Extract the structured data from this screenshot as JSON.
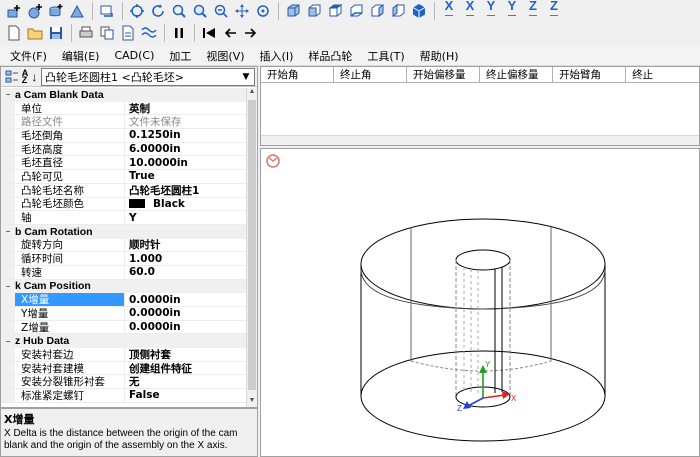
{
  "toolbar1": {
    "axis_labels": [
      "X",
      "X",
      "Y",
      "Y",
      "Z",
      "Z"
    ]
  },
  "menubar": {
    "items": [
      "文件(F)",
      "编辑(E)",
      "CAD(C)",
      "加工",
      "视图(V)",
      "插入(I)",
      "样品凸轮",
      "工具(T)",
      "帮助(H)"
    ]
  },
  "property_panel": {
    "object_selector": "凸轮毛坯圆柱1 <凸轮毛坯>",
    "categories": [
      {
        "title": "a Cam Blank Data",
        "rows": [
          {
            "name": "单位",
            "value": "英制"
          },
          {
            "name": "路径文件",
            "value": "文件未保存"
          },
          {
            "name": "毛坯倒角",
            "value": "0.1250in"
          },
          {
            "name": "毛坯高度",
            "value": "6.0000in"
          },
          {
            "name": "毛坯直径",
            "value": "10.0000in"
          },
          {
            "name": "凸轮可见",
            "value": "True"
          },
          {
            "name": "凸轮毛坯名称",
            "value": "凸轮毛坯圆柱1"
          },
          {
            "name": "凸轮毛坯颜色",
            "value": "Black"
          },
          {
            "name": "轴",
            "value": "Y"
          }
        ]
      },
      {
        "title": "b Cam Rotation",
        "rows": [
          {
            "name": "旋转方向",
            "value": "顺时针"
          },
          {
            "name": "循环时间",
            "value": "1.000"
          },
          {
            "name": "转速",
            "value": "60.0"
          }
        ]
      },
      {
        "title": "k Cam Position",
        "rows": [
          {
            "name": "X增量",
            "value": "0.0000in"
          },
          {
            "name": "Y增量",
            "value": "0.0000in"
          },
          {
            "name": "Z增量",
            "value": "0.0000in"
          }
        ]
      },
      {
        "title": "z Hub Data",
        "rows": [
          {
            "name": "安装衬套边",
            "value": "顶侧衬套"
          },
          {
            "name": "安装衬套建模",
            "value": "创建组件特征"
          },
          {
            "name": "安装分裂锥形衬套",
            "value": "无"
          },
          {
            "name": "标准紧定螺钉",
            "value": "False"
          }
        ]
      }
    ],
    "collapse_symbol": "−",
    "selected_row": "X增量"
  },
  "description": {
    "title": "X增量",
    "text": "X Delta is the distance between the origin of the cam blank and the origin of the assembly on the X axis."
  },
  "table": {
    "columns": [
      "开始角",
      "终止角",
      "开始偏移量",
      "终止偏移量",
      "开始臂角",
      "终止"
    ]
  },
  "viewport": {
    "triad_labels": [
      "Y",
      "X",
      "Z"
    ]
  },
  "colors": {
    "selection": "#3399ff",
    "toolbar_blue": "#1e62c8",
    "axis_x": "#e02020",
    "axis_y": "#20a020",
    "axis_z": "#2040e0"
  }
}
